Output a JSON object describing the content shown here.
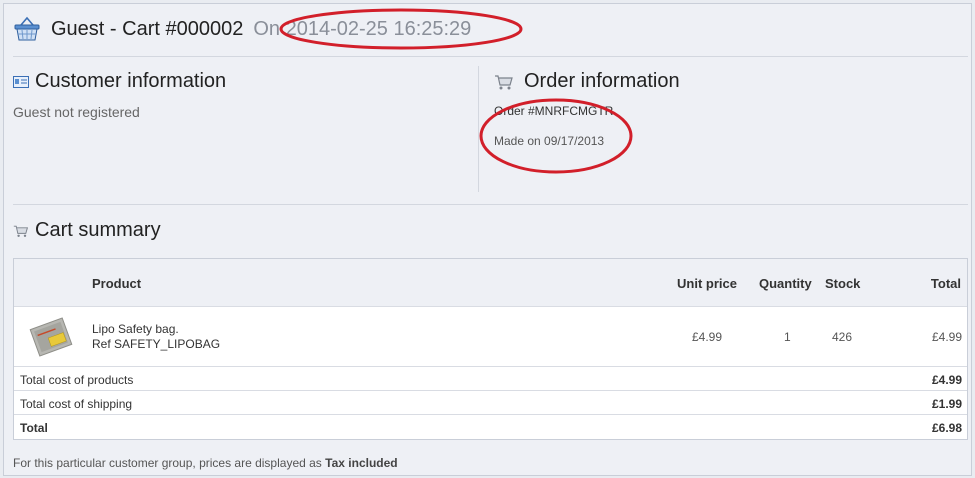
{
  "header": {
    "title": "Guest - Cart #000002",
    "on_prefix": "On",
    "datetime": "2014-02-25 16:25:29"
  },
  "customer": {
    "title": "Customer information",
    "status": "Guest not registered"
  },
  "order": {
    "title": "Order information",
    "order_ref": "Order #MNRFCMGTR",
    "made_on": "Made on 09/17/2013"
  },
  "cart_summary": {
    "title": "Cart summary",
    "columns": {
      "product": "Product",
      "unit_price": "Unit price",
      "quantity": "Quantity",
      "stock": "Stock",
      "total": "Total"
    },
    "items": [
      {
        "name": "Lipo Safety bag.",
        "ref": "Ref SAFETY_LIPOBAG",
        "unit_price": "£4.99",
        "quantity": "1",
        "stock": "426",
        "total": "£4.99"
      }
    ],
    "totals": {
      "products_label": "Total cost of products",
      "products_value": "£4.99",
      "shipping_label": "Total cost of shipping",
      "shipping_value": "£1.99",
      "total_label": "Total",
      "total_value": "£6.98"
    }
  },
  "footer": {
    "note_prefix": "For this particular customer group, prices are displayed as",
    "note_emphasis": "Tax included"
  },
  "annotation_color": "#d21f2a"
}
